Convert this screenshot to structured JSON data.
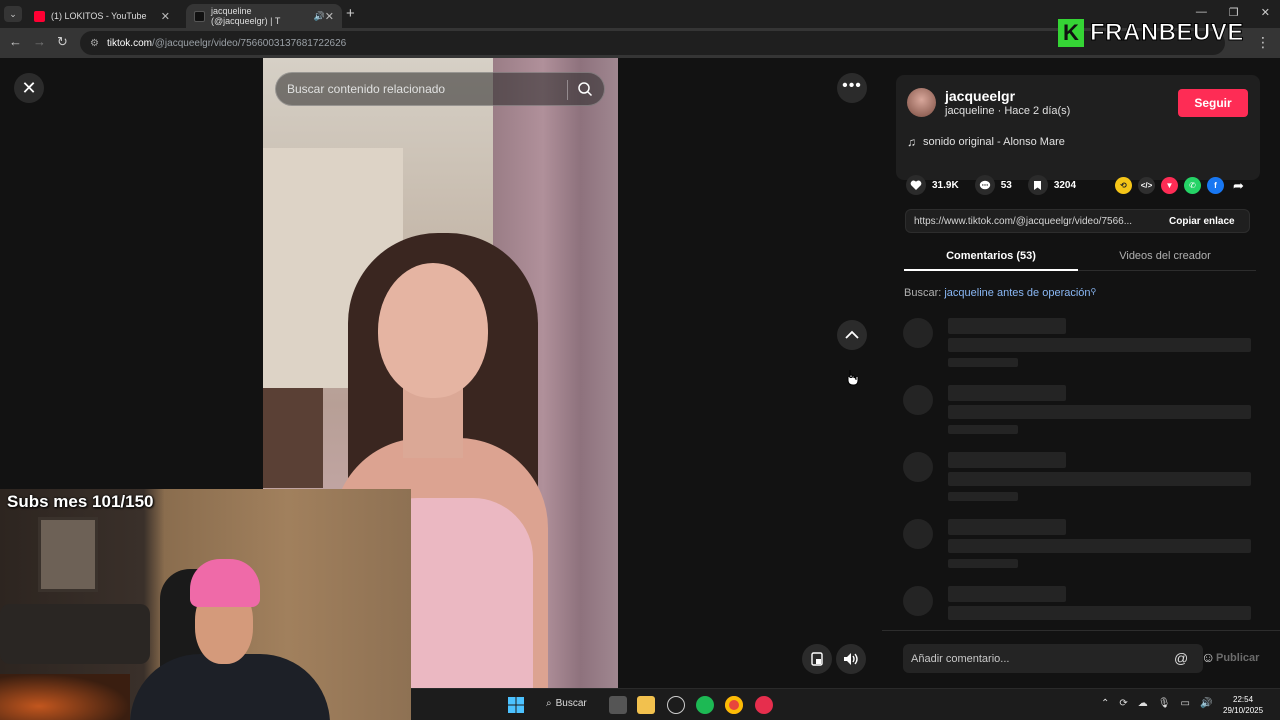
{
  "browser": {
    "tabs": [
      {
        "title": "(1) LOKITOS - YouTube",
        "favicon_color": "#ff0033"
      },
      {
        "title": "jacqueline (@jacqueelgr) | T",
        "favicon_color": "#111111"
      }
    ],
    "url_domain": "tiktok.com",
    "url_path": "/@jacqueelgr/video/7566003137681722626"
  },
  "overlay_logo": {
    "letter": "K",
    "name": "FRANBEUVE"
  },
  "player": {
    "search_placeholder": "Buscar contenido relacionado"
  },
  "webcam": {
    "subs_label": "Subs mes 101/150"
  },
  "panel": {
    "username": "jacqueelgr",
    "subline": "jacqueline · Hace 2 día(s)",
    "follow_label": "Seguir",
    "sound": "sonido original - Alonso Mare",
    "stats": {
      "likes": "31.9K",
      "comments": "53",
      "saves": "3204"
    },
    "link_url": "https://www.tiktok.com/@jacqueelgr/video/7566...",
    "copy_link_label": "Copiar enlace",
    "tabs": [
      "Comentarios (53)",
      "Videos del creador"
    ],
    "search_prefix": "Buscar:",
    "search_query": "jacqueline antes de operación",
    "comment_placeholder": "Añadir comentario...",
    "publish_label": "Publicar"
  },
  "taskbar": {
    "search_label": "Buscar",
    "time": "22:54",
    "date": "29/10/2025"
  },
  "colors": {
    "accent": "#fe2c55",
    "link": "#8ab8f5"
  }
}
